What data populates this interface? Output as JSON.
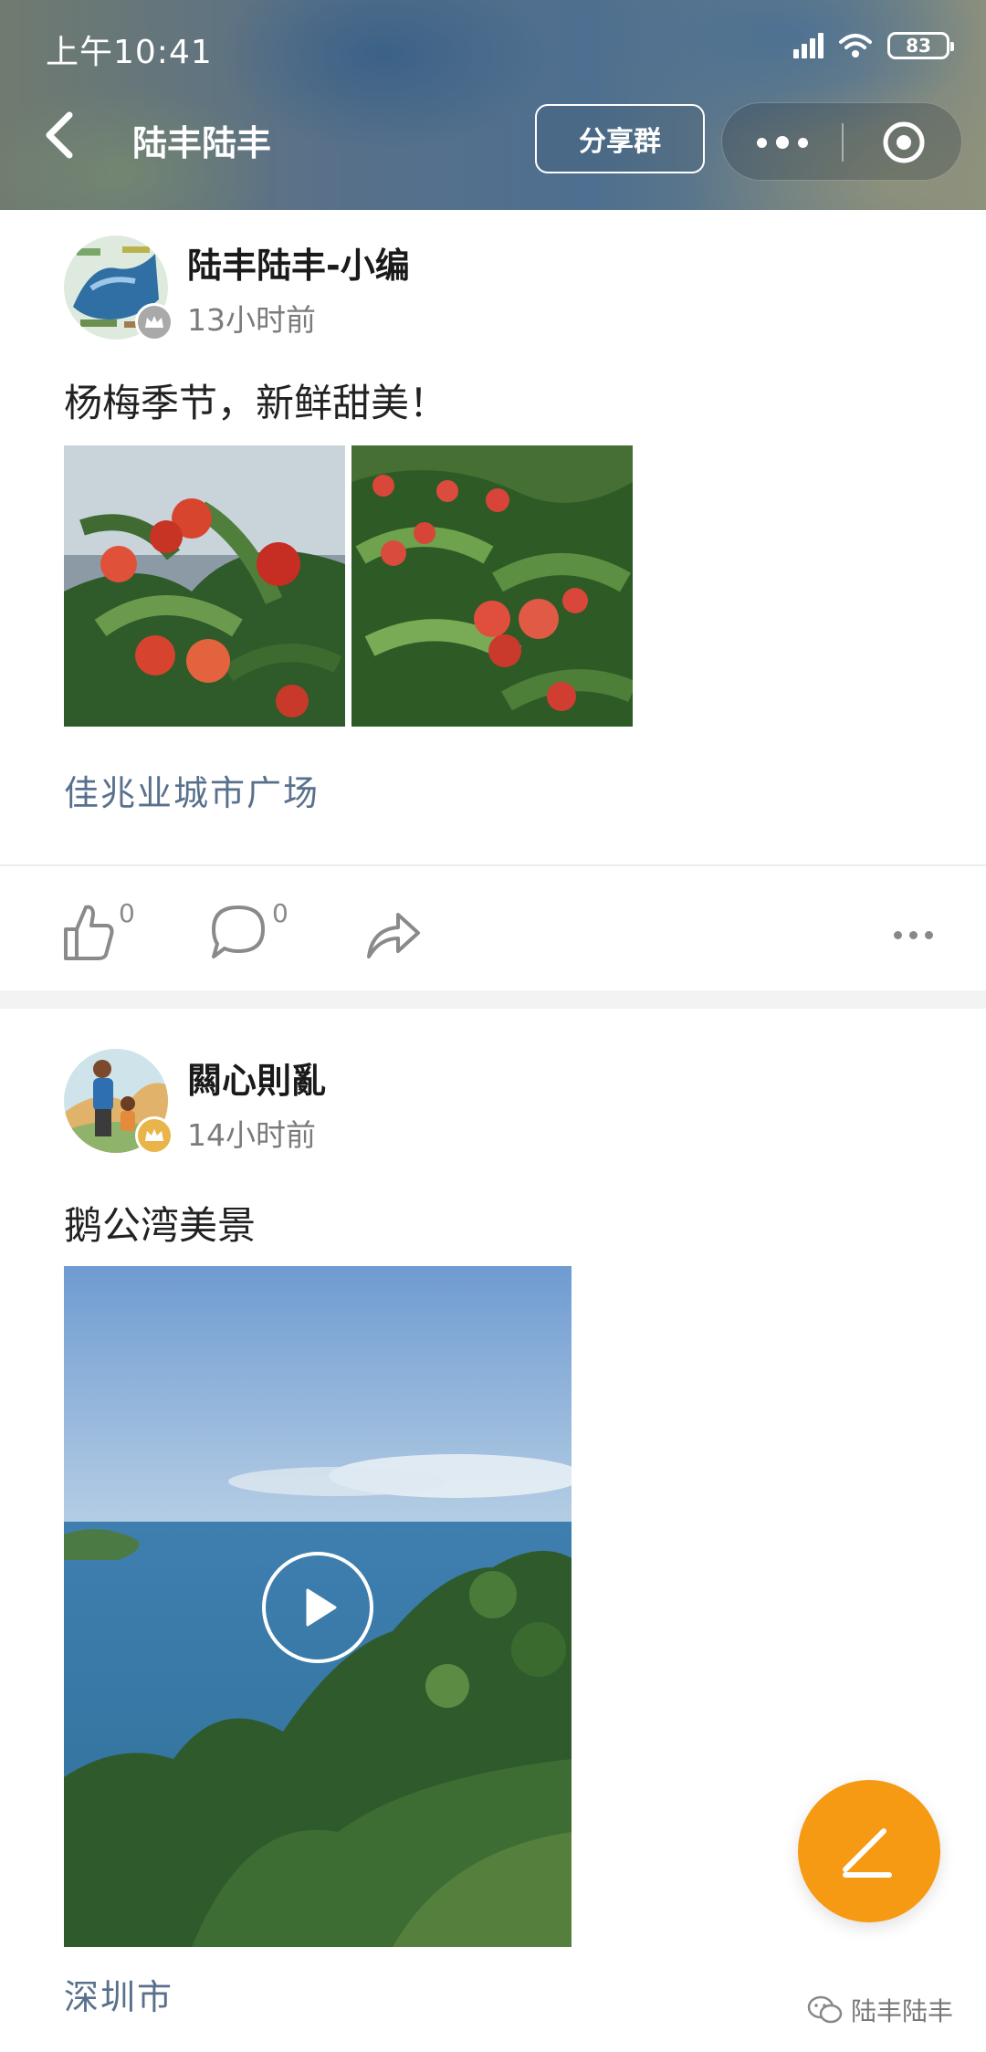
{
  "status_bar": {
    "time": "上午10:41",
    "battery": "83"
  },
  "nav": {
    "title": "陆丰陆丰",
    "share_label": "分享群"
  },
  "posts": [
    {
      "author": "陆丰陆丰-小编",
      "time": "13小时前",
      "content": "杨梅季节，新鲜甜美！",
      "location": "佳兆业城市广场",
      "likes": "0",
      "comments": "0"
    },
    {
      "author": "闗心則亂",
      "time": "14小时前",
      "content": "鹅公湾美景",
      "location": "深圳市"
    }
  ],
  "watermark": "陆丰陆丰",
  "colors": {
    "accent_fab": "#f59a12",
    "location_link": "#58708c"
  }
}
